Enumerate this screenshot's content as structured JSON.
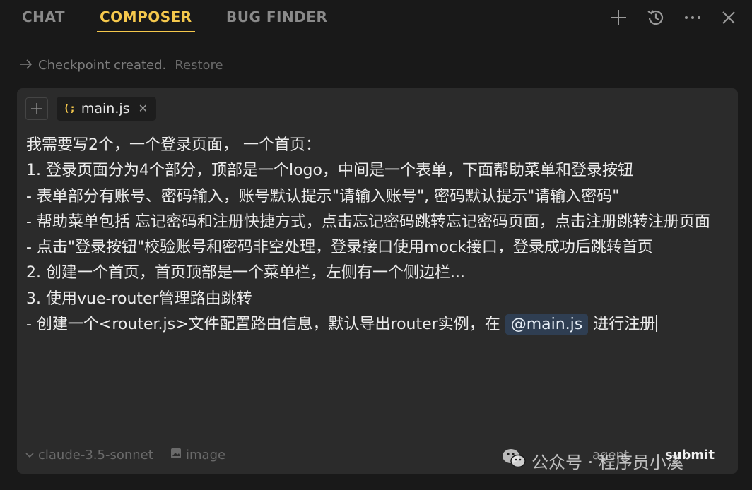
{
  "tabs": [
    {
      "label": "CHAT",
      "active": false
    },
    {
      "label": "COMPOSER",
      "active": true
    },
    {
      "label": "BUG FINDER",
      "active": false
    }
  ],
  "toolbar_icons": [
    "plus-icon",
    "history-icon",
    "more-icon",
    "close-icon"
  ],
  "checkpoint": {
    "text": "Checkpoint created.",
    "restore": "Restore"
  },
  "context": {
    "file_name": "main.js",
    "file_icon": "(;"
  },
  "prompt": {
    "lines": [
      "我需要写2个，一个登录页面， 一个首页：",
      "1. 登录页面分为4个部分，顶部是一个logo，中间是一个表单，下面帮助菜单和登录按钮",
      "- 表单部分有账号、密码输入，账号默认提示\"请输入账号\", 密码默认提示\"请输入密码\"",
      "- 帮助菜单包括 忘记密码和注册快捷方式，点击忘记密码跳转忘记密码页面，点击注册跳转注册页面",
      "- 点击\"登录按钮\"校验账号和密码非空处理，登录接口使用mock接口，登录成功后跳转首页",
      "2. 创建一个首页，首页顶部是一个菜单栏，左侧有一个侧边栏...",
      "3. 使用vue-router管理路由跳转"
    ],
    "last_line_before": "- 创建一个<router.js>文件配置路由信息，默认导出router实例，在 ",
    "mention": "@main.js",
    "last_line_after": " 进行注册"
  },
  "bottom": {
    "model": "claude-3.5-sonnet",
    "image": "image",
    "agent": "agent",
    "submit": "submit"
  },
  "watermark": {
    "text": "公众号 · 程序员小溪"
  },
  "colors": {
    "accent": "#f5c84c",
    "panel": "#2b2b2b",
    "background": "#191919",
    "mention_bg": "#2f3e52"
  }
}
